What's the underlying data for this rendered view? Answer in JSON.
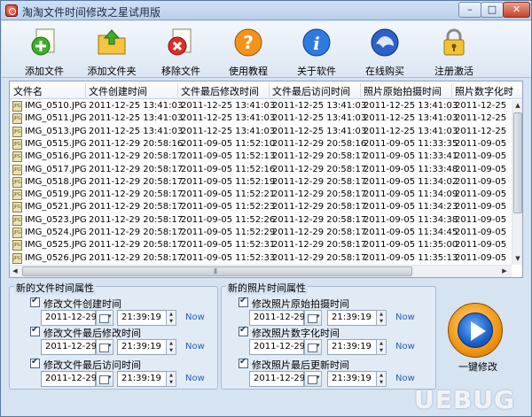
{
  "window": {
    "title": "淘淘文件时间修改之星试用版",
    "min": "–",
    "max": "□",
    "close": "✕"
  },
  "toolbar": [
    {
      "label": "添加文件",
      "icon": "add-file-icon"
    },
    {
      "label": "添加文件夹",
      "icon": "add-folder-icon"
    },
    {
      "label": "移除文件",
      "icon": "remove-file-icon"
    },
    {
      "label": "使用教程",
      "icon": "help-icon"
    },
    {
      "label": "关于软件",
      "icon": "info-icon"
    },
    {
      "label": "在线购买",
      "icon": "buy-online-icon"
    },
    {
      "label": "注册激活",
      "icon": "lock-icon"
    }
  ],
  "grid": {
    "columns": [
      "文件名",
      "文件创建时间",
      "文件最后修改时间",
      "文件最后访问时间",
      "照片原始拍摄时间",
      "照片数字化时"
    ],
    "rows": [
      [
        "IMG_0510.JPG",
        "2011-12-25 13:41:03",
        "2011-12-25 13:41:03",
        "2011-12-25 13:41:03",
        "2011-12-25 13:41:03",
        "2011-12-25"
      ],
      [
        "IMG_0511.JPG",
        "2011-12-25 13:41:03",
        "2011-12-25 13:41:03",
        "2011-12-25 13:41:03",
        "2011-12-25 13:41:03",
        "2011-12-25"
      ],
      [
        "IMG_0513.JPG",
        "2011-12-25 13:41:03",
        "2011-12-25 13:41:03",
        "2011-12-25 13:41:03",
        "2011-12-25 13:41:03",
        "2011-12-25"
      ],
      [
        "IMG_0515.JPG",
        "2011-12-29 20:58:16",
        "2011-09-05 11:52:10",
        "2011-12-29 20:58:16",
        "2011-09-05 11:33:35",
        "2011-09-05"
      ],
      [
        "IMG_0516.JPG",
        "2011-12-29 20:58:17",
        "2011-09-05 11:52:13",
        "2011-12-29 20:58:17",
        "2011-09-05 11:33:41",
        "2011-09-05"
      ],
      [
        "IMG_0517.JPG",
        "2011-12-29 20:58:17",
        "2011-09-05 11:52:16",
        "2011-12-29 20:58:17",
        "2011-09-05 11:33:48",
        "2011-09-05"
      ],
      [
        "IMG_0518.JPG",
        "2011-12-29 20:58:17",
        "2011-09-05 11:52:19",
        "2011-12-29 20:58:17",
        "2011-09-05 11:34:02",
        "2011-09-05"
      ],
      [
        "IMG_0519.JPG",
        "2011-12-29 20:58:17",
        "2011-09-05 11:52:21",
        "2011-12-29 20:58:17",
        "2011-09-05 11:34:09",
        "2011-09-05"
      ],
      [
        "IMG_0521.JPG",
        "2011-12-29 20:58:17",
        "2011-09-05 11:52:23",
        "2011-12-29 20:58:17",
        "2011-09-05 11:34:23",
        "2011-09-05"
      ],
      [
        "IMG_0523.JPG",
        "2011-12-29 20:58:17",
        "2011-09-05 11:52:26",
        "2011-12-29 20:58:17",
        "2011-09-05 11:34:38",
        "2011-09-05"
      ],
      [
        "IMG_0524.JPG",
        "2011-12-29 20:58:17",
        "2011-09-05 11:52:29",
        "2011-12-29 20:58:17",
        "2011-09-05 11:34:45",
        "2011-09-05"
      ],
      [
        "IMG_0525.JPG",
        "2011-12-29 20:58:17",
        "2011-09-05 11:52:31",
        "2011-12-29 20:58:17",
        "2011-09-05 11:35:00",
        "2011-09-05"
      ],
      [
        "IMG_0526.JPG",
        "2011-12-29 20:58:17",
        "2011-09-05 11:52:33",
        "2011-12-29 20:58:17",
        "2011-09-05 11:35:13",
        "2011-09-05"
      ]
    ],
    "file_icon_text": "JPG"
  },
  "file_group": {
    "title": "新的文件时间属性",
    "items": [
      {
        "label": "修改文件创建时间",
        "date": "2011-12-29",
        "time": "21:39:19",
        "now": "Now"
      },
      {
        "label": "修改文件最后修改时间",
        "date": "2011-12-29",
        "time": "21:39:19",
        "now": "Now"
      },
      {
        "label": "修改文件最后访问时间",
        "date": "2011-12-29",
        "time": "21:39:19",
        "now": "Now"
      }
    ]
  },
  "photo_group": {
    "title": "新的照片时间属性",
    "items": [
      {
        "label": "修改照片原始拍摄时间",
        "date": "2011-12-29",
        "time": "21:39:19",
        "now": "Now"
      },
      {
        "label": "修改照片数字化时间",
        "date": "2011-12-29",
        "time": "21:39:19",
        "now": "Now"
      },
      {
        "label": "修改照片最后更新时间",
        "date": "2011-12-29",
        "time": "21:39:19",
        "now": "Now"
      }
    ]
  },
  "apply": {
    "label": "一键修改"
  },
  "watermark": "UEBUG"
}
